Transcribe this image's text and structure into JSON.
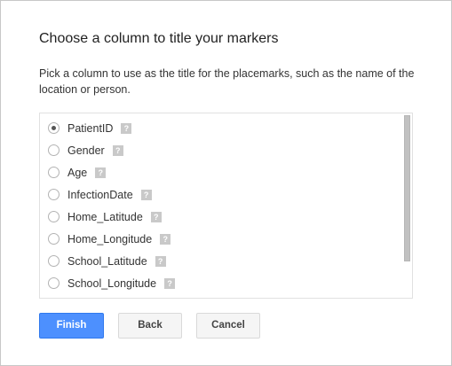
{
  "dialog": {
    "title": "Choose a column to title your markers",
    "description": "Pick a column to use as the title for the placemarks, such as the name of the location or person."
  },
  "options": [
    {
      "label": "PatientID",
      "selected": true
    },
    {
      "label": "Gender",
      "selected": false
    },
    {
      "label": "Age",
      "selected": false
    },
    {
      "label": "InfectionDate",
      "selected": false
    },
    {
      "label": "Home_Latitude",
      "selected": false
    },
    {
      "label": "Home_Longitude",
      "selected": false
    },
    {
      "label": "School_Latitude",
      "selected": false
    },
    {
      "label": "School_Longitude",
      "selected": false
    }
  ],
  "help_icon_glyph": "?",
  "buttons": {
    "finish": "Finish",
    "back": "Back",
    "cancel": "Cancel"
  },
  "colors": {
    "primary": "#4d90fe",
    "help_icon": "#c9c9c9"
  }
}
